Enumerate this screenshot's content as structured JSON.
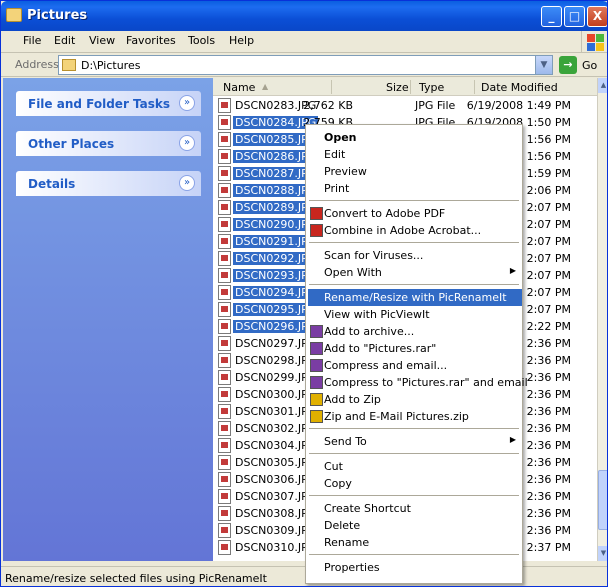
{
  "window": {
    "title": "Pictures",
    "minimize": "_",
    "maximize": "□",
    "close": "X"
  },
  "menubar": [
    "File",
    "Edit",
    "View",
    "Favorites",
    "Tools",
    "Help"
  ],
  "address": {
    "label": "Address",
    "value": "D:\\Pictures",
    "go": "Go"
  },
  "tasks": [
    {
      "label": "File and Folder Tasks",
      "chevron": "»"
    },
    {
      "label": "Other Places",
      "chevron": "»"
    },
    {
      "label": "Details",
      "chevron": "»"
    }
  ],
  "columns": {
    "name": "Name",
    "size": "Size",
    "type": "Type",
    "date": "Date Modified"
  },
  "files": [
    {
      "name": "DSCN0283.JPG",
      "size": "2,762 KB",
      "type": "JPG File",
      "date": "6/19/2008 1:49 PM",
      "selected": false
    },
    {
      "name": "DSCN0284.JPG",
      "size": "2,759 KB",
      "type": "JPG File",
      "date": "6/19/2008 1:50 PM",
      "selected": true
    },
    {
      "name": "DSCN0285.JPG",
      "size": "",
      "type": "",
      "date": "8 1:56 PM",
      "selected": true
    },
    {
      "name": "DSCN0286.JPG",
      "size": "",
      "type": "",
      "date": "8 1:56 PM",
      "selected": true
    },
    {
      "name": "DSCN0287.JPG",
      "size": "",
      "type": "",
      "date": "8 1:59 PM",
      "selected": true
    },
    {
      "name": "DSCN0288.JPG",
      "size": "",
      "type": "",
      "date": "8 2:06 PM",
      "selected": true
    },
    {
      "name": "DSCN0289.JPG",
      "size": "",
      "type": "",
      "date": "8 2:07 PM",
      "selected": true
    },
    {
      "name": "DSCN0290.JPG",
      "size": "",
      "type": "",
      "date": "8 2:07 PM",
      "selected": true
    },
    {
      "name": "DSCN0291.JPG",
      "size": "",
      "type": "",
      "date": "8 2:07 PM",
      "selected": true
    },
    {
      "name": "DSCN0292.JPG",
      "size": "",
      "type": "",
      "date": "8 2:07 PM",
      "selected": true
    },
    {
      "name": "DSCN0293.JPG",
      "size": "",
      "type": "",
      "date": "8 2:07 PM",
      "selected": true
    },
    {
      "name": "DSCN0294.JPG",
      "size": "",
      "type": "",
      "date": "8 2:07 PM",
      "selected": true
    },
    {
      "name": "DSCN0295.JPG",
      "size": "",
      "type": "",
      "date": "8 2:07 PM",
      "selected": true
    },
    {
      "name": "DSCN0296.JPG",
      "size": "",
      "type": "",
      "date": "8 2:22 PM",
      "selected": true
    },
    {
      "name": "DSCN0297.JPG",
      "size": "",
      "type": "",
      "date": "8 2:36 PM",
      "selected": false
    },
    {
      "name": "DSCN0298.JPG",
      "size": "",
      "type": "",
      "date": "8 2:36 PM",
      "selected": false
    },
    {
      "name": "DSCN0299.JPG",
      "size": "",
      "type": "",
      "date": "8 2:36 PM",
      "selected": false
    },
    {
      "name": "DSCN0300.JPG",
      "size": "",
      "type": "",
      "date": "8 2:36 PM",
      "selected": false
    },
    {
      "name": "DSCN0301.JPG",
      "size": "",
      "type": "",
      "date": "8 2:36 PM",
      "selected": false
    },
    {
      "name": "DSCN0302.JPG",
      "size": "",
      "type": "",
      "date": "8 2:36 PM",
      "selected": false
    },
    {
      "name": "DSCN0304.JPG",
      "size": "",
      "type": "",
      "date": "8 2:36 PM",
      "selected": false
    },
    {
      "name": "DSCN0305.JPG",
      "size": "",
      "type": "",
      "date": "8 2:36 PM",
      "selected": false
    },
    {
      "name": "DSCN0306.JPG",
      "size": "",
      "type": "",
      "date": "8 2:36 PM",
      "selected": false
    },
    {
      "name": "DSCN0307.JPG",
      "size": "",
      "type": "",
      "date": "8 2:36 PM",
      "selected": false
    },
    {
      "name": "DSCN0308.JPG",
      "size": "",
      "type": "",
      "date": "8 2:36 PM",
      "selected": false
    },
    {
      "name": "DSCN0309.JPG",
      "size": "",
      "type": "",
      "date": "8 2:36 PM",
      "selected": false
    },
    {
      "name": "DSCN0310.JPG",
      "size": "",
      "type": "",
      "date": "8 2:37 PM",
      "selected": false
    }
  ],
  "context_menu": {
    "items": [
      {
        "label": "Open",
        "bold": true
      },
      {
        "label": "Edit"
      },
      {
        "label": "Preview"
      },
      {
        "label": "Print"
      },
      {
        "sep": true
      },
      {
        "label": "Convert to Adobe PDF",
        "icon": "pdf-icon"
      },
      {
        "label": "Combine in Adobe Acrobat...",
        "icon": "acrobat-icon"
      },
      {
        "sep": true
      },
      {
        "label": "Scan for Viruses..."
      },
      {
        "label": "Open With",
        "submenu": true
      },
      {
        "sep": true
      },
      {
        "label": "Rename/Resize with PicRenameIt",
        "highlighted": true
      },
      {
        "label": "View with PicViewIt"
      },
      {
        "label": "Add to archive...",
        "icon": "rar-icon"
      },
      {
        "label": "Add to \"Pictures.rar\"",
        "icon": "rar-icon"
      },
      {
        "label": "Compress and email...",
        "icon": "rar-icon"
      },
      {
        "label": "Compress to \"Pictures.rar\" and email",
        "icon": "rar-icon"
      },
      {
        "label": "Add to Zip",
        "icon": "zip-icon"
      },
      {
        "label": "Zip and E-Mail Pictures.zip",
        "icon": "zip-icon"
      },
      {
        "sep": true
      },
      {
        "label": "Send To",
        "submenu": true
      },
      {
        "sep": true
      },
      {
        "label": "Cut"
      },
      {
        "label": "Copy"
      },
      {
        "sep": true
      },
      {
        "label": "Create Shortcut"
      },
      {
        "label": "Delete"
      },
      {
        "label": "Rename"
      },
      {
        "sep": true
      },
      {
        "label": "Properties"
      }
    ]
  },
  "status": "Rename/resize selected files using PicRenameIt",
  "colors": {
    "title_blue": "#0a5fe0",
    "selection": "#316ac5",
    "task_pane": "#7ba2e7"
  }
}
